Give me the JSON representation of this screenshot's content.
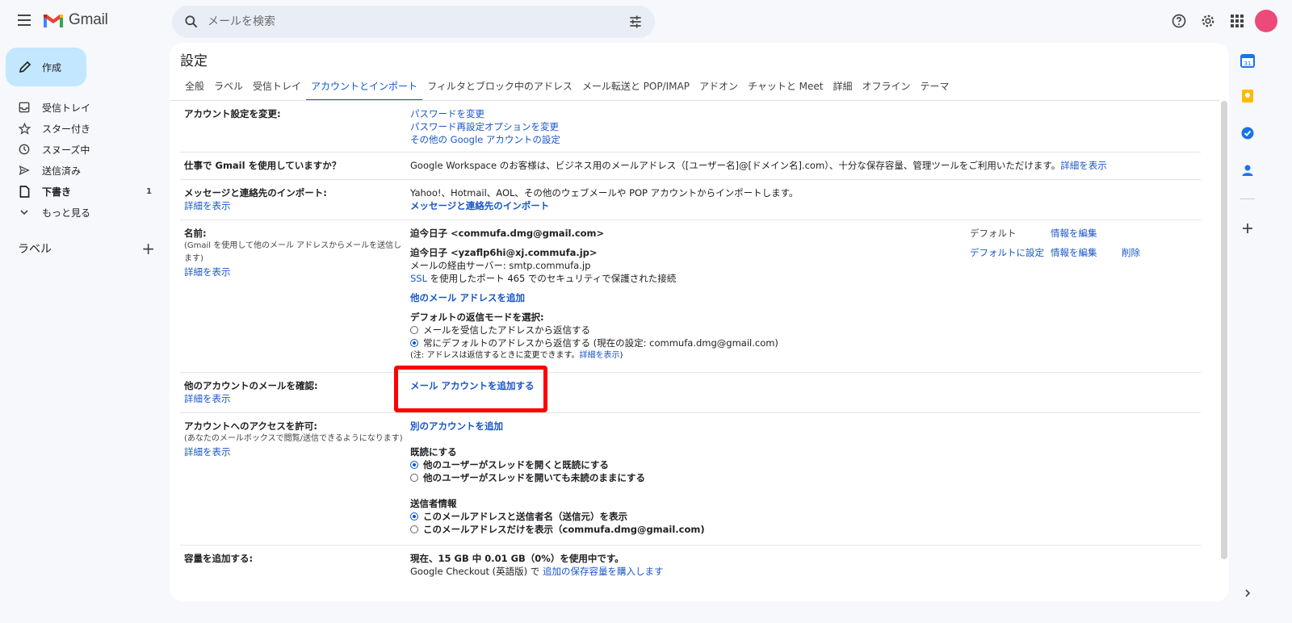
{
  "app": {
    "name": "Gmail"
  },
  "search": {
    "placeholder": "メールを検索"
  },
  "compose": {
    "label": "作成"
  },
  "nav": [
    {
      "label": "受信トレイ",
      "count": ""
    },
    {
      "label": "スター付き",
      "count": ""
    },
    {
      "label": "スヌーズ中",
      "count": ""
    },
    {
      "label": "送信済み",
      "count": ""
    },
    {
      "label": "下書き",
      "count": "1"
    },
    {
      "label": "もっと見る",
      "count": ""
    }
  ],
  "labels": {
    "title": "ラベル",
    "add": "+"
  },
  "settings": {
    "title": "設定",
    "tabs": [
      "全般",
      "ラベル",
      "受信トレイ",
      "アカウントとインポート",
      "フィルタとブロック中のアドレス",
      "メール転送と POP/IMAP",
      "アドオン",
      "チャットと Meet",
      "詳細",
      "オフライン",
      "テーマ"
    ],
    "active_tab": "アカウントとインポート",
    "rows": {
      "account": {
        "label": "アカウント設定を変更:",
        "links": [
          "パスワードを変更",
          "パスワード再設定オプションを変更",
          "その他の Google アカウントの設定"
        ]
      },
      "work": {
        "label": "仕事で Gmail を使用していますか？",
        "text": "Google Workspace のお客様は、ビジネス用のメールアドレス（[ユーザー名]@[ドメイン名].com）、十分な保存容量、管理ツールをご利用いただけます。",
        "link": "詳細を表示"
      },
      "import": {
        "label": "メッセージと連絡先のインポート:",
        "learn": "詳細を表示",
        "text": "Yahoo!、Hotmail、AOL、その他のウェブメールや POP アカウントからインポートします。",
        "link": "メッセージと連絡先のインポート"
      },
      "name": {
        "label": "名前:",
        "sub": "(Gmail を使用して他のメール アドレスからメールを送信します)",
        "learn": "詳細を表示",
        "address1": "迫今日子 <commufa.dmg@gmail.com>",
        "default_label": "デフォルト",
        "edit1": "情報を編集",
        "address2": "迫今日子 <yzaflp6hi@xj.commufa.jp>",
        "set_default": "デフォルトに設定",
        "edit2": "情報を編集",
        "delete": "削除",
        "server": "メールの経由サーバー: smtp.commufa.jp",
        "ssl_link": "SSL",
        "ssl_text": " を使用したポート 465 でのセキュリティで保護された接続",
        "add_address": "他のメール アドレスを追加",
        "reply_mode_title": "デフォルトの返信モードを選択:",
        "reply_opt1": "メールを受信したアドレスから返信する",
        "reply_opt2": "常にデフォルトのアドレスから返信する (現在の設定: commufa.dmg@gmail.com)",
        "note": "(注: アドレスは返信するときに変更できます。",
        "note_link": "詳細を表示",
        "note_end": ")"
      },
      "check": {
        "label": "他のアカウントのメールを確認:",
        "learn": "詳細を表示",
        "link": "メール アカウントを追加する"
      },
      "grant": {
        "label": "アカウントへのアクセスを許可:",
        "sub": "(あなたのメールボックスで閲覧/送信できるようになります)",
        "learn": "詳細を表示",
        "add_link": "別のアカウントを追加",
        "read_title": "既読にする",
        "read_opt1": "他のユーザーがスレッドを開くと既読にする",
        "read_opt2": "他のユーザーがスレッドを開いても未読のままにする",
        "sender_title": "送信者情報",
        "sender_opt1": "このメールアドレスと送信者名（送信元）を表示",
        "sender_opt2": "このメールアドレスだけを表示（commufa.dmg@gmail.com)"
      },
      "storage": {
        "label": "容量を追加する:",
        "usage": "現在、15 GB 中 0.01 GB（0%）を使用中です。",
        "checkout": "Google Checkout (英語版) で ",
        "buy_link": "追加の保存容量を購入します"
      }
    }
  },
  "colors": {
    "accent": "#0b57d0",
    "link": "#1a56c8",
    "compose_bg": "#c2e7ff",
    "highlight": "#ff0000",
    "avatar": "#ec4a78"
  }
}
